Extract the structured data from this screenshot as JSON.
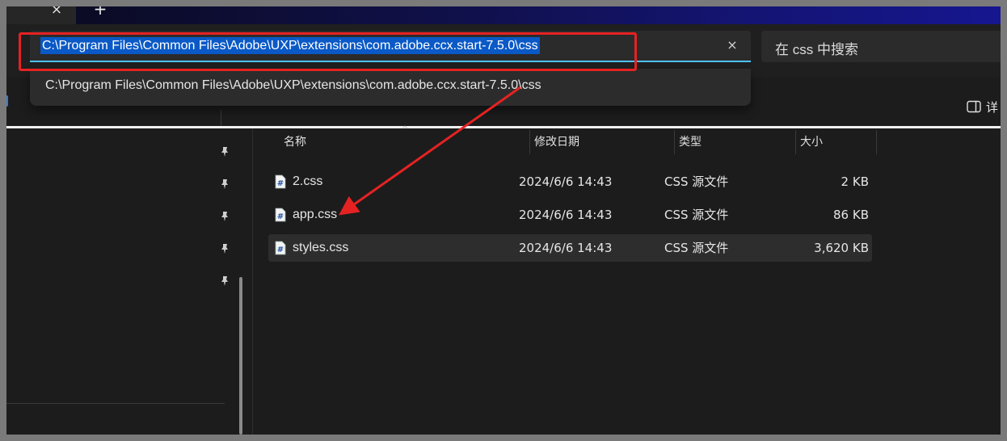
{
  "tabs": {
    "close_glyph": "×",
    "new_glyph": "+"
  },
  "address": {
    "path": "C:\\Program Files\\Common Files\\Adobe\\UXP\\extensions\\com.adobe.ccx.start-7.5.0\\css",
    "clear_glyph": "×"
  },
  "search": {
    "placeholder": "在 css 中搜索"
  },
  "suggestion": {
    "text": "C:\\Program Files\\Common Files\\Adobe\\UXP\\extensions\\com.adobe.ccx.start-7.5.0\\css"
  },
  "toolbar": {
    "details_label": "详"
  },
  "columns": {
    "name": "名称",
    "modified": "修改日期",
    "type": "类型",
    "size": "大小"
  },
  "files": [
    {
      "name": "2.css",
      "modified": "2024/6/6 14:43",
      "type": "CSS 源文件",
      "size": "2 KB",
      "selected": false
    },
    {
      "name": "app.css",
      "modified": "2024/6/6 14:43",
      "type": "CSS 源文件",
      "size": "86 KB",
      "selected": false
    },
    {
      "name": "styles.css",
      "modified": "2024/6/6 14:43",
      "type": "CSS 源文件",
      "size": "3,620 KB",
      "selected": true
    }
  ],
  "colors": {
    "highlight_red": "#e52222",
    "selection_blue": "#0a59c6",
    "focus_accent": "#4cc2ff",
    "window_bg": "#1c1c1c"
  },
  "icons": {
    "file": "css-file-icon",
    "pin": "pin-icon",
    "clear": "close-icon",
    "details": "details-pane-icon"
  }
}
